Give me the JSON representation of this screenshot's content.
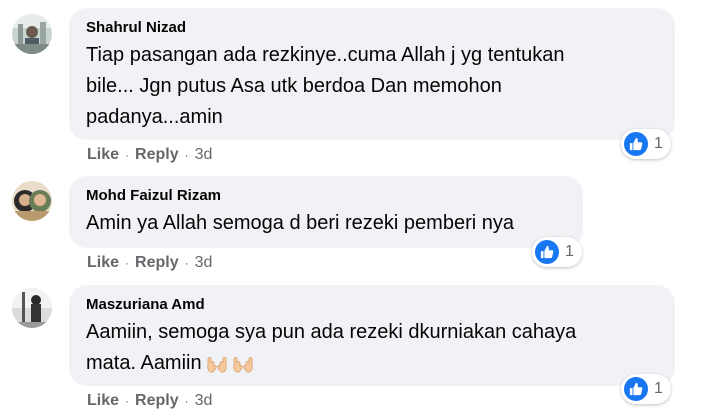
{
  "comments": [
    {
      "author": "Shahrul Nizad",
      "lines": [
        "Tiap pasangan ada rezkinye..cuma Allah j yg tentukan",
        "bile... Jgn putus Asa utk berdoa Dan memohon",
        "padanya...amin"
      ],
      "like_label": "Like",
      "reply_label": "Reply",
      "time": "3d",
      "reaction_icon": "thumbs-up-icon",
      "reaction_count": "1"
    },
    {
      "author": "Mohd Faizul Rizam",
      "lines": [
        "Amin ya Allah semoga d beri rezeki pemberi nya"
      ],
      "like_label": "Like",
      "reply_label": "Reply",
      "time": "3d",
      "reaction_icon": "thumbs-up-icon",
      "reaction_count": "1"
    },
    {
      "author": "Maszuriana Amd",
      "lines": [
        "Aamiin, semoga sya pun ada rezeki dkurniakan cahaya",
        "mata. Aamiin"
      ],
      "emoji": [
        "open-hands-emoji",
        "open-hands-emoji"
      ],
      "like_label": "Like",
      "reply_label": "Reply",
      "time": "3d",
      "reaction_icon": "thumbs-up-icon",
      "reaction_count": "1"
    }
  ],
  "colors": {
    "bubble": "#f0f2f5",
    "like_blue": "#1877f2",
    "meta_gray": "#65676b",
    "text": "#050505"
  }
}
